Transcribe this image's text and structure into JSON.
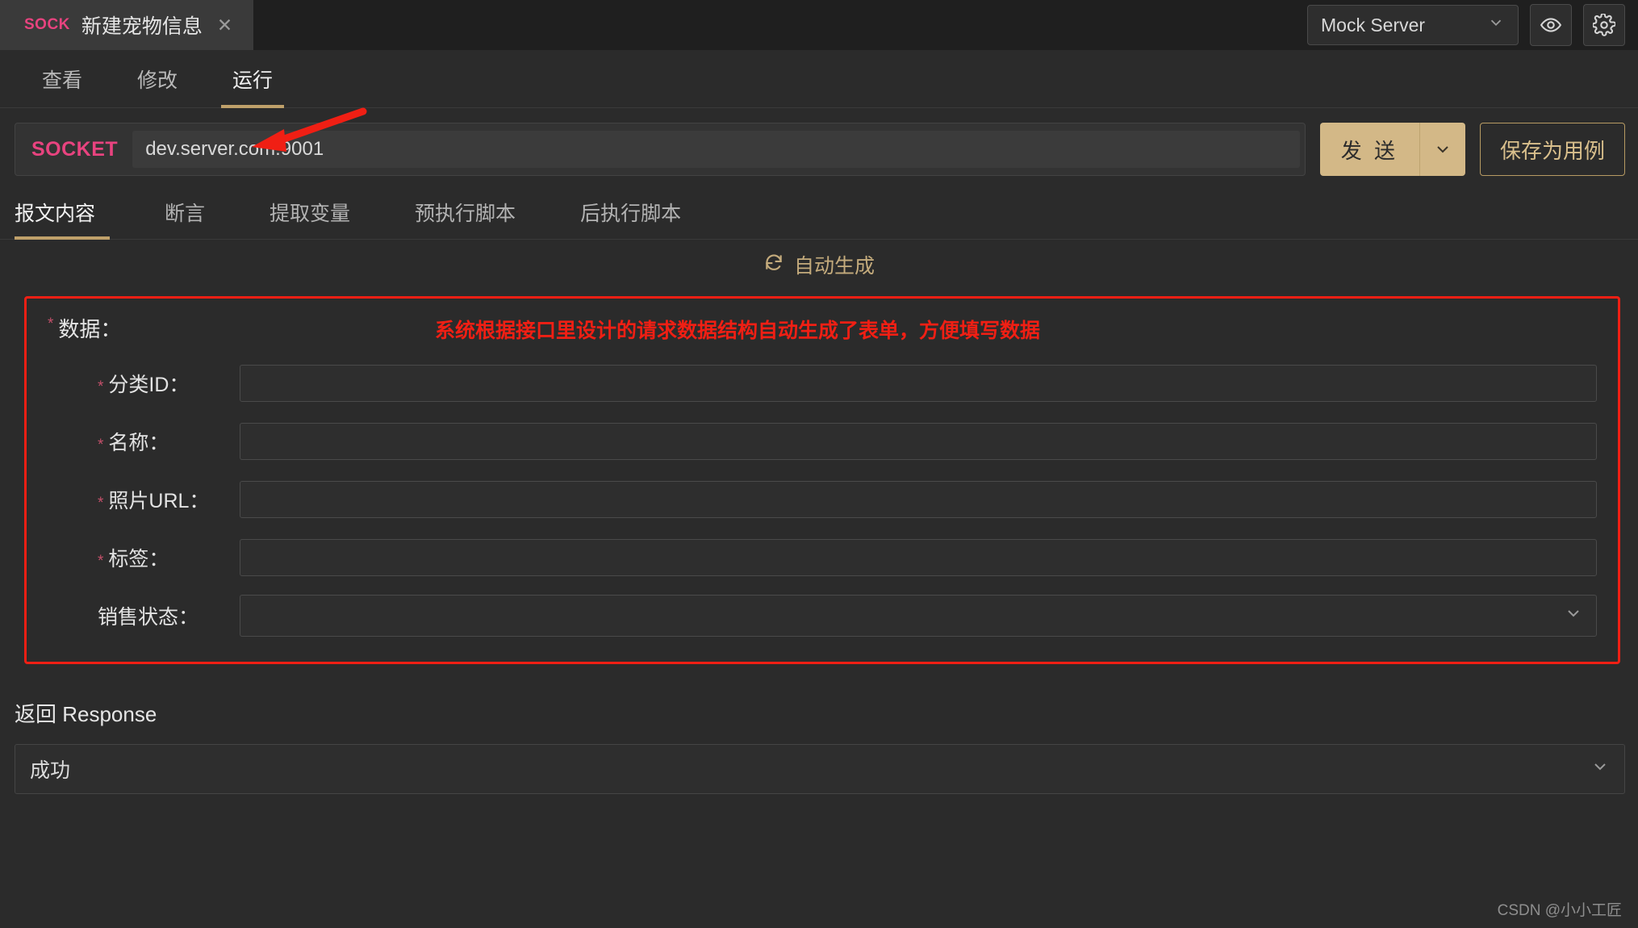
{
  "tab": {
    "protocol_badge": "SOCK",
    "title": "新建宠物信息",
    "close": "✕"
  },
  "topbar": {
    "mock_server_label": "Mock Server",
    "mock_server_chevron": "chevron-down-icon",
    "preview_icon": "eye-icon",
    "settings_icon": "gear-icon"
  },
  "nav_tabs": [
    {
      "label": "查看",
      "active": false
    },
    {
      "label": "修改",
      "active": false
    },
    {
      "label": "运行",
      "active": true
    }
  ],
  "request": {
    "method": "SOCKET",
    "url": "dev.server.com:9001",
    "send_label": "发 送",
    "send_chevron": "chevron-down-icon",
    "save_label": "保存为用例"
  },
  "sub_tabs": [
    {
      "label": "报文内容",
      "active": true
    },
    {
      "label": "断言",
      "active": false
    },
    {
      "label": "提取变量",
      "active": false
    },
    {
      "label": "预执行脚本",
      "active": false
    },
    {
      "label": "后执行脚本",
      "active": false
    }
  ],
  "autogen": {
    "icon": "refresh-icon",
    "label": "自动生成"
  },
  "form": {
    "required_marker": "*",
    "section_label": "数据：",
    "annotation": "系统根据接口里设计的请求数据结构自动生成了表单，方便填写数据",
    "fields": [
      {
        "label": "分类ID：",
        "required": true,
        "type": "text",
        "value": ""
      },
      {
        "label": "名称：",
        "required": true,
        "type": "text",
        "value": ""
      },
      {
        "label": "照片URL：",
        "required": true,
        "type": "text",
        "value": ""
      },
      {
        "label": "标签：",
        "required": true,
        "type": "text",
        "value": ""
      },
      {
        "label": "销售状态：",
        "required": false,
        "type": "select",
        "value": ""
      }
    ]
  },
  "response": {
    "title": "返回 Response",
    "selected": "成功",
    "chevron": "chevron-down-icon"
  },
  "watermark": "CSDN @小小工匠",
  "colors": {
    "accent_gold": "#d3b887",
    "accent_pink": "#e8437f",
    "annotation_red": "#f01f14",
    "background": "#2b2b2b"
  }
}
